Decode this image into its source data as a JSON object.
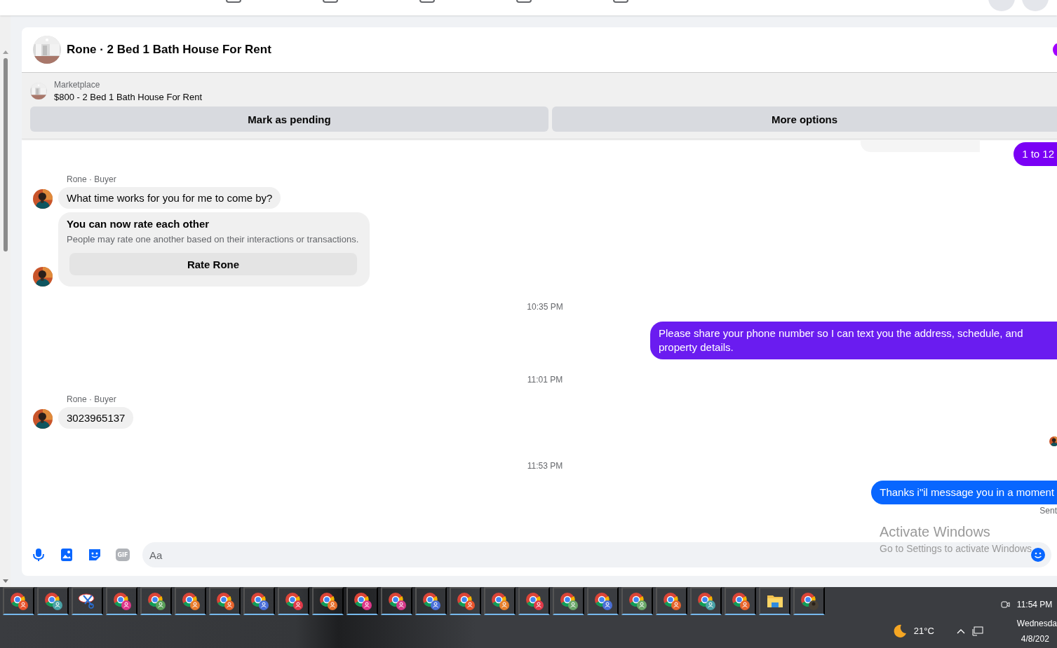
{
  "conversation": {
    "title": "Rone · 2 Bed 1 Bath House For Rent"
  },
  "listing": {
    "source": "Marketplace",
    "title": "$800 - 2 Bed 1 Bath House For Rent",
    "actions": [
      "Mark as pending",
      "More options"
    ]
  },
  "messages": [
    {
      "kind": "outgoing",
      "text": "1 to 12",
      "color": "#7a00f5"
    },
    {
      "kind": "incoming",
      "sender": "Rone · Buyer",
      "text": "What time works for you for me to come by?"
    },
    {
      "kind": "rating",
      "title": "You can now rate each other",
      "text": "People may rate one another based on their interactions or transactions.",
      "button": "Rate Rone"
    },
    {
      "kind": "timestamp",
      "text": "10:35 PM"
    },
    {
      "kind": "outgoing",
      "text": "Please share your phone number so I can text you the address, schedule, and property details.",
      "color": "#6a1cf0"
    },
    {
      "kind": "timestamp",
      "text": "11:01 PM"
    },
    {
      "kind": "incoming",
      "sender": "Rone · Buyer",
      "text": "3023965137"
    },
    {
      "kind": "seen"
    },
    {
      "kind": "timestamp",
      "text": "11:53 PM"
    },
    {
      "kind": "outgoing",
      "text": "Thanks i\"il message you in a moment",
      "color": "#0866ff"
    },
    {
      "kind": "status",
      "text": "Sent"
    }
  ],
  "composer": {
    "placeholder": "Aa",
    "gif_label": "GIF"
  },
  "os_watermark": {
    "title": "Activate Windows",
    "subtitle": "Go to Settings to activate Windows"
  },
  "taskbar": {
    "apps": [
      {
        "kind": "browser",
        "color": "#e8532c"
      },
      {
        "kind": "browser",
        "color": "#4aa3a8"
      },
      {
        "kind": "snip"
      },
      {
        "kind": "browser",
        "color": "#e0368a"
      },
      {
        "kind": "browser",
        "color": "#5aa05a"
      },
      {
        "kind": "browser",
        "color": "#e87a2c"
      },
      {
        "kind": "browser",
        "color": "#e8632c"
      },
      {
        "kind": "browser",
        "color": "#4a6fd8"
      },
      {
        "kind": "browser",
        "color": "#e23a4a"
      },
      {
        "kind": "browser",
        "color": "#e8702c"
      },
      {
        "kind": "browser",
        "color": "#e0368a"
      },
      {
        "kind": "browser",
        "color": "#d63a8a"
      },
      {
        "kind": "browser",
        "color": "#4a6fd8"
      },
      {
        "kind": "browser",
        "color": "#e8532c"
      },
      {
        "kind": "browser",
        "color": "#e8802c"
      },
      {
        "kind": "browser",
        "color": "#e23a4a"
      },
      {
        "kind": "browser",
        "color": "#6aa86a"
      },
      {
        "kind": "browser",
        "color": "#4a6fd8"
      },
      {
        "kind": "browser",
        "color": "#6aa86a"
      },
      {
        "kind": "browser",
        "color": "#e8632c"
      },
      {
        "kind": "browser",
        "color": "#4aa3a8"
      },
      {
        "kind": "browser",
        "color": "#e8632c"
      },
      {
        "kind": "folder"
      },
      {
        "kind": "browser-photo"
      }
    ],
    "weather": "21°C",
    "time": "11:54 PM",
    "day": "Wednesda",
    "date": "4/8/202"
  }
}
